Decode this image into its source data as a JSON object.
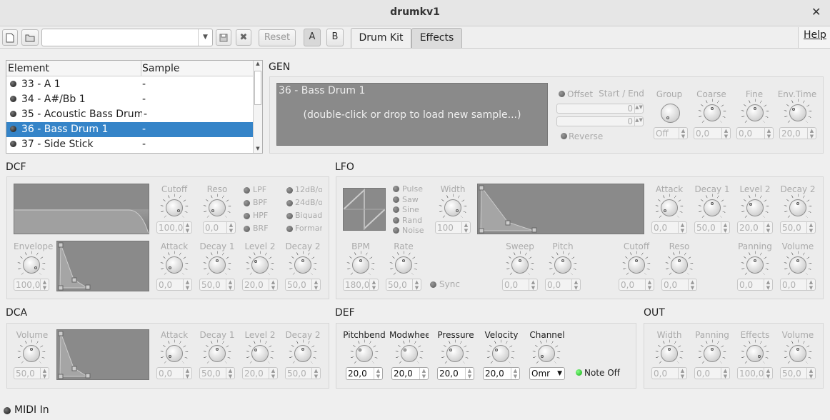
{
  "window": {
    "title": "drumkv1",
    "close": "✕"
  },
  "toolbar": {
    "new_icon": "new-file-icon",
    "open_icon": "open-folder-icon",
    "preset_value": "",
    "save_icon": "save-icon",
    "delete_icon": "delete-icon",
    "reset": "Reset",
    "a": "A",
    "b": "B",
    "help": "Help"
  },
  "tabs": [
    "Drum Kit",
    "Effects"
  ],
  "elements": {
    "headers": [
      "Element",
      "Sample"
    ],
    "rows": [
      {
        "name": "33 - A 1",
        "sample": "-"
      },
      {
        "name": "34 - A#/Bb 1",
        "sample": "-"
      },
      {
        "name": "35 - Acoustic Bass Drum",
        "sample": "-"
      },
      {
        "name": "36 - Bass Drum 1",
        "sample": "-",
        "selected": true
      },
      {
        "name": "37 - Side Stick",
        "sample": "-"
      }
    ]
  },
  "gen": {
    "title": "GEN",
    "sample_name": "36 - Bass Drum 1",
    "hint": "(double-click or drop to load new sample...)",
    "offset": "Offset",
    "start_end": "Start / End",
    "start": "0",
    "end": "0",
    "reverse": "Reverse",
    "group": {
      "label": "Group",
      "value": "Off"
    },
    "coarse": {
      "label": "Coarse",
      "value": "0,0"
    },
    "fine": {
      "label": "Fine",
      "value": "0,0"
    },
    "envtime": {
      "label": "Env.Time",
      "value": "20,0"
    }
  },
  "dcf": {
    "title": "DCF",
    "cutoff": {
      "label": "Cutoff",
      "value": "100,0"
    },
    "reso": {
      "label": "Reso",
      "value": "0,0"
    },
    "types": [
      "LPF",
      "BPF",
      "HPF",
      "BRF"
    ],
    "slopes": [
      "12dB/o",
      "24dB/o",
      "Biquad",
      "Formar"
    ],
    "envelope": {
      "label": "Envelope",
      "value": "100,0"
    },
    "attack": {
      "label": "Attack",
      "value": "0,0"
    },
    "decay1": {
      "label": "Decay 1",
      "value": "50,0"
    },
    "level2": {
      "label": "Level 2",
      "value": "20,0"
    },
    "decay2": {
      "label": "Decay 2",
      "value": "50,0"
    }
  },
  "lfo": {
    "title": "LFO",
    "waves": [
      "Pulse",
      "Saw",
      "Sine",
      "Rand",
      "Noise"
    ],
    "width": {
      "label": "Width",
      "value": "100"
    },
    "attack": {
      "label": "Attack",
      "value": "0,0"
    },
    "decay1": {
      "label": "Decay 1",
      "value": "50,0"
    },
    "level2": {
      "label": "Level 2",
      "value": "20,0"
    },
    "decay2": {
      "label": "Decay 2",
      "value": "50,0"
    },
    "bpm": {
      "label": "BPM",
      "value": "180,0"
    },
    "rate": {
      "label": "Rate",
      "value": "50,0"
    },
    "sync": "Sync",
    "sweep": {
      "label": "Sweep",
      "value": "0,0"
    },
    "pitch": {
      "label": "Pitch",
      "value": "0,0"
    },
    "cutoff": {
      "label": "Cutoff",
      "value": "0,0"
    },
    "reso": {
      "label": "Reso",
      "value": "0,0"
    },
    "panning": {
      "label": "Panning",
      "value": "0,0"
    },
    "volume": {
      "label": "Volume",
      "value": "0,0"
    }
  },
  "dca": {
    "title": "DCA",
    "volume": {
      "label": "Volume",
      "value": "50,0"
    },
    "attack": {
      "label": "Attack",
      "value": "0,0"
    },
    "decay1": {
      "label": "Decay 1",
      "value": "50,0"
    },
    "level2": {
      "label": "Level 2",
      "value": "20,0"
    },
    "decay2": {
      "label": "Decay 2",
      "value": "50,0"
    }
  },
  "def": {
    "title": "DEF",
    "pitchbend": {
      "label": "Pitchbend",
      "value": "20,0"
    },
    "modwheel": {
      "label": "Modwheel",
      "value": "20,0"
    },
    "pressure": {
      "label": "Pressure",
      "value": "20,0"
    },
    "velocity": {
      "label": "Velocity",
      "value": "20,0"
    },
    "channel": {
      "label": "Channel",
      "value": "Omr"
    },
    "noteoff": "Note Off"
  },
  "out": {
    "title": "OUT",
    "width": {
      "label": "Width",
      "value": "0,0"
    },
    "panning": {
      "label": "Panning",
      "value": "0,0"
    },
    "effects": {
      "label": "Effects",
      "value": "100,0"
    },
    "volume": {
      "label": "Volume",
      "value": "50,0"
    }
  },
  "status": {
    "midi_in": "MIDI In"
  }
}
